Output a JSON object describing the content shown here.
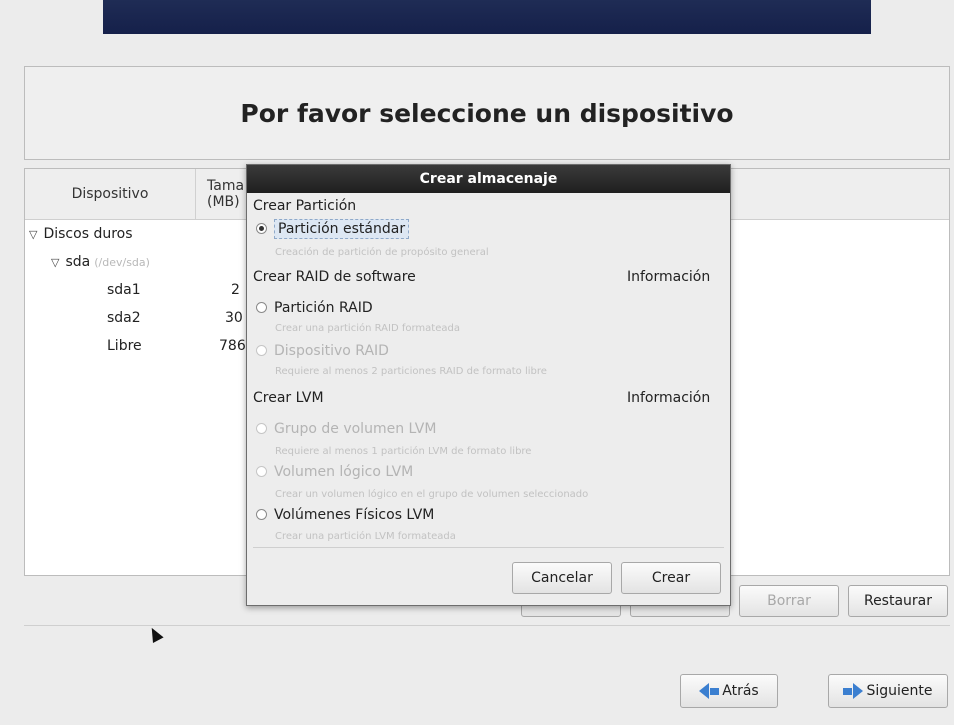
{
  "header": {
    "title": "Por favor seleccione un dispositivo"
  },
  "table": {
    "columns": [
      "Dispositivo",
      "Tama",
      "(MB)"
    ],
    "rows": {
      "group": "Discos duros",
      "disk": "sda",
      "disk_hint": "(/dev/sda)",
      "items": [
        {
          "name": "sda1",
          "size": "2"
        },
        {
          "name": "sda2",
          "size": "30"
        },
        {
          "name": "Libre",
          "size": "786"
        }
      ]
    }
  },
  "buttons": {
    "borrar": "Borrar",
    "restaurar": "Restaurar",
    "atras": "Atrás",
    "siguiente": "Siguiente"
  },
  "dialog": {
    "title": "Crear almacenaje",
    "section_partition": "Crear Partición",
    "opt_standard": "Partición estándar",
    "opt_standard_desc": "Creación de partición de propósito general",
    "section_raid": "Crear RAID de software",
    "info_label": "Información",
    "opt_raid_partition": "Partición RAID",
    "opt_raid_partition_desc": "Crear una partición RAID formateada",
    "opt_raid_device": "Dispositivo RAID",
    "opt_raid_device_desc": "Requiere al menos 2 particiones RAID de formato libre",
    "section_lvm": "Crear LVM",
    "opt_lvm_group": "Grupo de volumen LVM",
    "opt_lvm_group_desc": "Requiere al menos 1 partición LVM de formato libre",
    "opt_lvm_logical": "Volumen lógico LVM",
    "opt_lvm_logical_desc": "Crear un volumen lógico en el grupo de volumen seleccionado",
    "opt_lvm_physical": "Volúmenes Físicos LVM",
    "opt_lvm_physical_desc": "Crear una partición LVM formateada",
    "cancel": "Cancelar",
    "create": "Crear"
  },
  "colors": {
    "banner": "#1f2c55",
    "dialog_title": "#2a2a2a",
    "arrow": "#3b7fd0"
  }
}
